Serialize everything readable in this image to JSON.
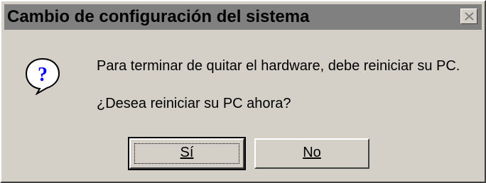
{
  "window": {
    "title": "Cambio de configuración del sistema"
  },
  "dialog": {
    "icon": "question-icon",
    "message_line1": "Para terminar de quitar el hardware, debe reiniciar su PC.",
    "message_line2": "¿Desea reiniciar su PC ahora?"
  },
  "buttons": {
    "yes_label": "Sí",
    "no_label": "No"
  },
  "colors": {
    "titlebar": "#808080",
    "face": "#d4d0c8",
    "icon_blue": "#0000ff"
  }
}
